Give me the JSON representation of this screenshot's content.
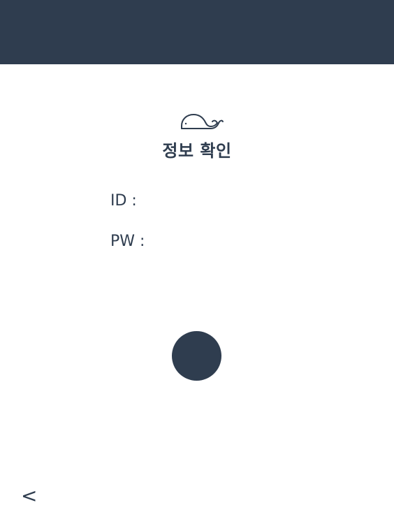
{
  "header": {
    "color": "#2f3d4f"
  },
  "logo": {
    "icon": "whale-icon"
  },
  "title": "정보 확인",
  "fields": {
    "id_label": "ID :",
    "id_value": "",
    "pw_label": "PW :",
    "pw_value": ""
  },
  "confirm_button": {
    "icon": "circle-button"
  },
  "back_button": {
    "label": "<"
  },
  "colors": {
    "primary": "#2f3d4f",
    "background": "#ffffff"
  }
}
